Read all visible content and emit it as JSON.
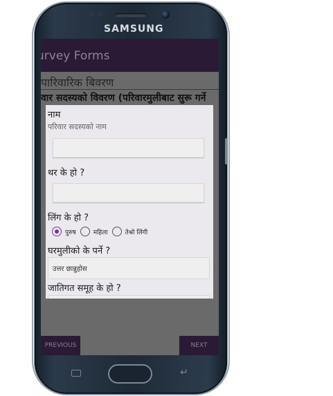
{
  "device": {
    "brand": "SAMSUNG"
  },
  "app": {
    "title": "urvey Forms",
    "background_heading": "पारिवारिक बिवरण",
    "background_subtitle": "वार सदस्यको विवरण (परिवारमुलीबाट सुरू गर्ने"
  },
  "dialog": {
    "name_label": "नाम",
    "name_hint": "परिवार सदस्यको नाम",
    "name_value": "",
    "surname_label": "थर के हो ?",
    "surname_value": "",
    "gender_label": "लिंग के हो ?",
    "gender_options": [
      "पुरुष",
      "महिला",
      "तेश्रो लिंगी"
    ],
    "gender_selected": "पुरुष",
    "relation_label": "घरमुलीको के पर्ने ?",
    "relation_value": "उत्तर छान्नुहोस",
    "caste_label": "जातिगत समूह के हो ?"
  },
  "navigation": {
    "previous_label": "PREVIOUS",
    "next_label": "NEXT"
  },
  "colors": {
    "appbar": "#2a1a35",
    "accent": "#7b2fa8",
    "dialog_bg": "#ece9ee"
  }
}
